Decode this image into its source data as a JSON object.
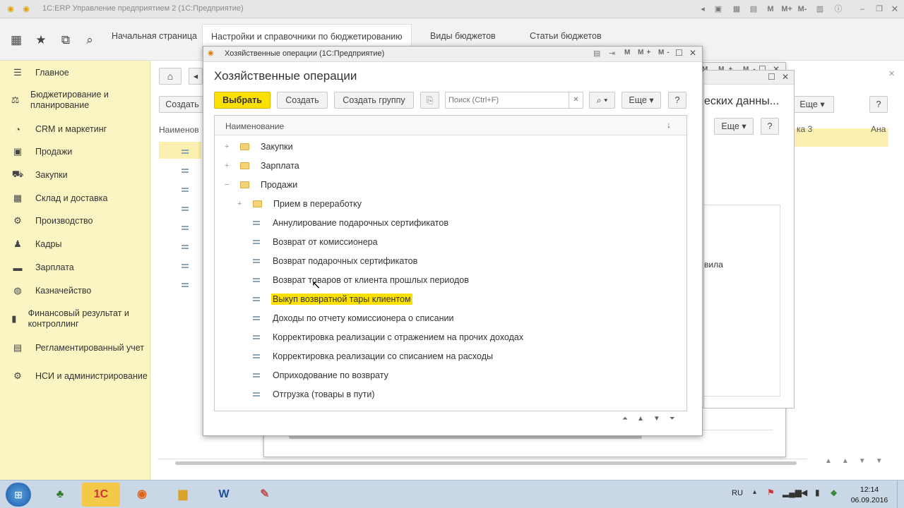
{
  "window": {
    "title": "1С:ERP Управление предприятием 2  (1С:Предприятие)",
    "controls": [
      "M",
      "M+",
      "M-"
    ]
  },
  "tabs": [
    {
      "label": "Начальная страница"
    },
    {
      "label": "Настройки и справочники по бюджетированию"
    },
    {
      "label": "Виды  бюджетов"
    },
    {
      "label": "Статьи бюджетов"
    }
  ],
  "sidebar": {
    "items": [
      {
        "label": "Главное",
        "icon": "menu-icon"
      },
      {
        "label": "Бюджетирование и планирование",
        "icon": "budget-icon"
      },
      {
        "label": "CRM и маркетинг",
        "icon": "crm-icon"
      },
      {
        "label": "Продажи",
        "icon": "sales-icon"
      },
      {
        "label": "Закупки",
        "icon": "cart-icon"
      },
      {
        "label": "Склад и доставка",
        "icon": "warehouse-icon"
      },
      {
        "label": "Производство",
        "icon": "production-icon"
      },
      {
        "label": "Кадры",
        "icon": "people-icon"
      },
      {
        "label": "Зарплата",
        "icon": "salary-icon"
      },
      {
        "label": "Казначейство",
        "icon": "treasury-icon"
      },
      {
        "label": "Финансовый результат и контроллинг",
        "icon": "chart-icon"
      },
      {
        "label": "Регламентированный учет",
        "icon": "ledger-icon"
      },
      {
        "label": "НСИ и администрирование",
        "icon": "gear-icon"
      }
    ]
  },
  "background": {
    "create_label": "Создать",
    "column_label": "Наименов",
    "more_label": "Еще",
    "help_label": "?",
    "title_partial": "еских данны...",
    "col3": "ка 3",
    "col4": "Ана",
    "fragment": "вила"
  },
  "dialog": {
    "window_title": "Хозяйственные операции (1С:Предприятие)",
    "heading": "Хозяйственные операции",
    "select_label": "Выбрать",
    "create_label": "Создать",
    "create_group_label": "Создать группу",
    "search_placeholder": "Поиск (Ctrl+F)",
    "more_label": "Еще",
    "help_label": "?",
    "column_header": "Наименование",
    "rows": [
      {
        "label": "Закупки",
        "type": "folder",
        "expander": "+"
      },
      {
        "label": "Зарплата",
        "type": "folder",
        "expander": "+"
      },
      {
        "label": "Продажи",
        "type": "folder",
        "expander": "−"
      },
      {
        "label": "Прием в переработку",
        "type": "folder",
        "expander": "+"
      },
      {
        "label": "Аннулирование подарочных сертификатов",
        "type": "item"
      },
      {
        "label": "Возврат от комиссионера",
        "type": "item"
      },
      {
        "label": "Возврат подарочных сертификатов",
        "type": "item"
      },
      {
        "label": "Возврат товаров от клиента прошлых периодов",
        "type": "item"
      },
      {
        "label": "Выкуп возвратной тары клиентом",
        "type": "item",
        "selected": true
      },
      {
        "label": "Доходы по отчету комиссионера о списании",
        "type": "item"
      },
      {
        "label": "Корректировка реализации с отражением на прочих доходах",
        "type": "item"
      },
      {
        "label": "Корректировка реализации со списанием на расходы",
        "type": "item"
      },
      {
        "label": "Оприходование по возврату",
        "type": "item"
      },
      {
        "label": "Отгрузка (товары в пути)",
        "type": "item"
      }
    ]
  },
  "taskbar": {
    "language": "RU",
    "time": "12:14",
    "date": "06.09.2016"
  },
  "colors": {
    "accent": "#fbe000",
    "sidebar": "#fbf5c4",
    "selected_row": "#fbf0b0"
  }
}
